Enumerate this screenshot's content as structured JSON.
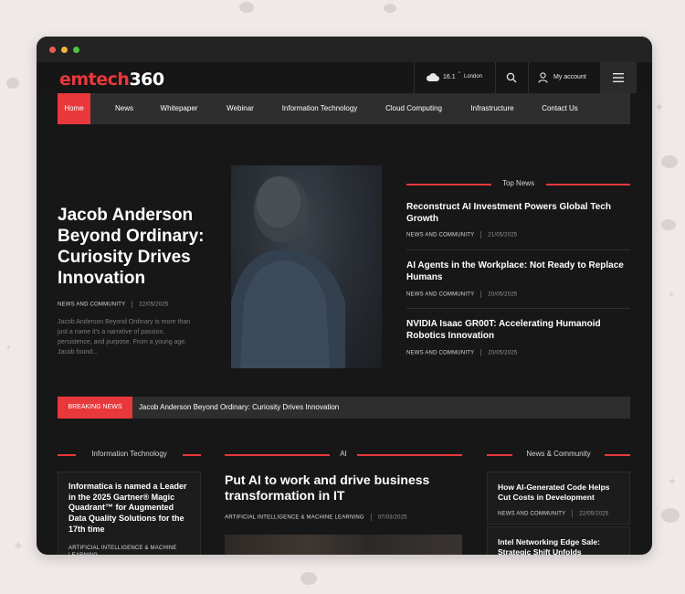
{
  "brand": {
    "logo_part1": "emtech",
    "logo_part2": "360"
  },
  "weather": {
    "temp": "16.1",
    "unit": "°",
    "city": "London",
    "icon": "cloud-icon"
  },
  "account": {
    "label": "My account"
  },
  "nav": {
    "items": [
      {
        "label": "Home",
        "active": true
      },
      {
        "label": "News"
      },
      {
        "label": "Whitepaper"
      },
      {
        "label": "Webinar"
      },
      {
        "label": "Information Technology"
      },
      {
        "label": "Cloud Computing"
      },
      {
        "label": "Infrastructure"
      },
      {
        "label": "Contact Us"
      }
    ]
  },
  "hero": {
    "title": "Jacob Anderson Beyond Ordinary: Curiosity Drives Innovation",
    "category": "NEWS AND COMMUNITY",
    "date": "22/05/2025",
    "excerpt": "Jacob Anderson Beyond Ordinary is more than just a name it's a narrative of passion, persistence, and purpose. From a young age, Jacob found..."
  },
  "top_news": {
    "heading": "Top News",
    "items": [
      {
        "title": "Reconstruct AI Investment Powers Global Tech Growth",
        "category": "NEWS AND COMMUNITY",
        "date": "21/05/2025"
      },
      {
        "title": "AI Agents in the Workplace: Not Ready to Replace Humans",
        "category": "NEWS AND COMMUNITY",
        "date": "20/05/2025"
      },
      {
        "title": "NVIDIA Isaac GR00T: Accelerating Humanoid Robotics Innovation",
        "category": "NEWS AND COMMUNITY",
        "date": "20/05/2025"
      }
    ]
  },
  "breaking": {
    "badge": "BREAKING NEWS",
    "text": "Jacob Anderson Beyond Ordinary: Curiosity Drives Innovation"
  },
  "sections": {
    "it": {
      "heading": "Information Technology",
      "card": {
        "title": "Informatica is named a Leader in the 2025 Gartner® Magic Quadrant™ for Augmented Data Quality Solutions for the 17th time",
        "category": "ARTIFICIAL INTELLIGENCE & MACHINE LEARNING"
      }
    },
    "ai": {
      "heading": "AI",
      "article": {
        "title": "Put AI to work and drive business transformation in IT",
        "category": "ARTIFICIAL INTELLIGENCE & MACHINE LEARNING",
        "date": "07/03/2025"
      }
    },
    "community": {
      "heading": "News & Community",
      "items": [
        {
          "title": "How AI-Generated Code Helps Cut Costs in Development",
          "category": "NEWS AND COMMUNITY",
          "date": "22/05/2025"
        },
        {
          "title": "Intel Networking Edge Sale: Strategic Shift Unfolds"
        }
      ]
    }
  },
  "colors": {
    "accent": "#e8383b",
    "background": "#171717",
    "nav_bg": "#2e2e2e"
  }
}
